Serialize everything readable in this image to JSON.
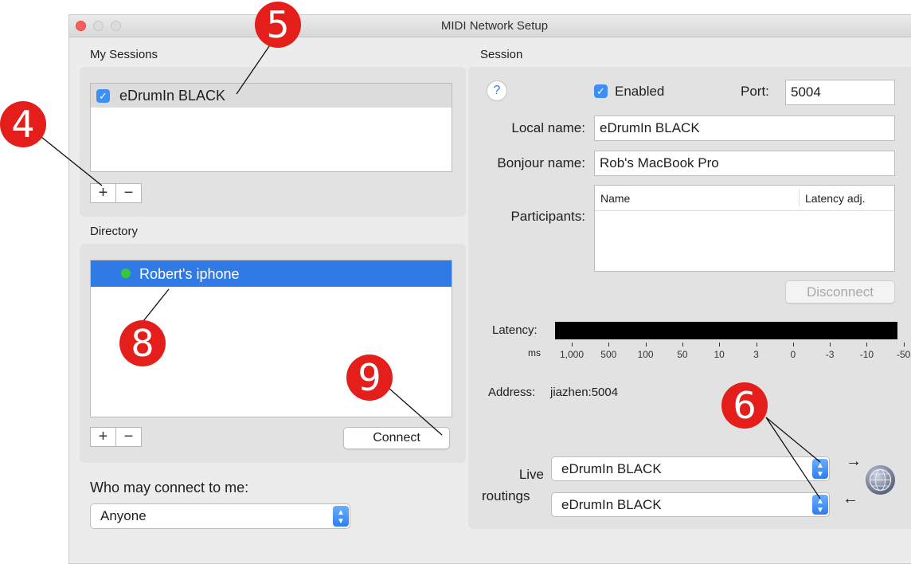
{
  "window": {
    "title": "MIDI Network Setup"
  },
  "my_sessions": {
    "label": "My Sessions",
    "items": [
      {
        "label": "eDrumIn BLACK",
        "checked": true
      }
    ],
    "add": "+",
    "remove": "−"
  },
  "directory": {
    "label": "Directory",
    "items": [
      {
        "label": "Robert's iphone",
        "status_color": "#37c837"
      }
    ],
    "add": "+",
    "remove": "−",
    "connect": "Connect"
  },
  "who_may_connect": {
    "label": "Who may connect to me:",
    "value": "Anyone"
  },
  "session": {
    "label": "Session",
    "help": "?",
    "enabled_label": "Enabled",
    "enabled": true,
    "port_label": "Port:",
    "port": "5004",
    "local_name_label": "Local name:",
    "local_name": "eDrumIn BLACK",
    "bonjour_name_label": "Bonjour name:",
    "bonjour_name": "Rob's MacBook Pro",
    "participants_label": "Participants:",
    "participants_columns": [
      "Name",
      "Latency adj."
    ],
    "disconnect": "Disconnect",
    "latency_label": "Latency:",
    "latency_unit": "ms",
    "latency_ticks": [
      "1,000",
      "500",
      "100",
      "50",
      "10",
      "3",
      "0",
      "-3",
      "-10",
      "-50"
    ],
    "address_label": "Address:",
    "address": "jiazhen:5004",
    "live_routings_label_1": "Live",
    "live_routings_label_2": "routings",
    "routing_out": "eDrumIn BLACK",
    "routing_in": "eDrumIn BLACK",
    "arrow_out": "→",
    "arrow_in": "←"
  },
  "annotations": {
    "a4": "4",
    "a5": "5",
    "a6": "6",
    "a8": "8",
    "a9": "9"
  },
  "colors": {
    "accent": "#3d8ff6",
    "selection": "#2f7ae5",
    "badge": "#e41e1b"
  }
}
